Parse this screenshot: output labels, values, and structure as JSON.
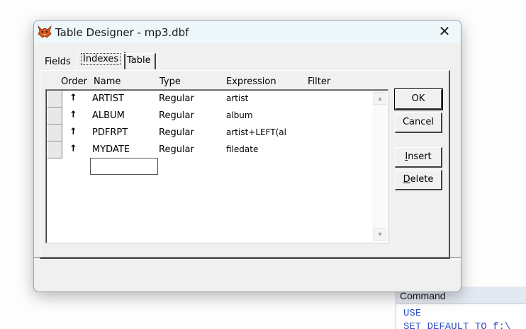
{
  "dialog": {
    "title": "Table Designer - mp3.dbf",
    "close_symbol": "✕"
  },
  "tabs": [
    {
      "label": "Fields"
    },
    {
      "label": "Indexes",
      "active": true
    },
    {
      "label": "Table"
    }
  ],
  "grid": {
    "columns": [
      "Order",
      "Name",
      "Type",
      "Expression",
      "Filter"
    ],
    "rows": [
      {
        "order": "↑",
        "name": "ARTIST",
        "type": "Regular",
        "expression": "artist"
      },
      {
        "order": "↑",
        "name": "ALBUM",
        "type": "Regular",
        "expression": "album"
      },
      {
        "order": "↑",
        "name": "PDFRPT",
        "type": "Regular",
        "expression": "artist+LEFT(al"
      },
      {
        "order": "↑",
        "name": "MYDATE",
        "type": "Regular",
        "expression": "filedate"
      }
    ],
    "new_row_value": ""
  },
  "buttons": {
    "ok": "OK",
    "cancel": "Cancel",
    "insert": "Insert",
    "delete": "Delete"
  },
  "command_window": {
    "title": "Command",
    "lines": [
      "USE",
      "SET DEFAULT TO f:\\"
    ]
  },
  "icons": {
    "app": "fox-icon",
    "scroll_up": "scroll-up-arrow-icon",
    "scroll_down": "scroll-down-arrow-icon"
  },
  "colors": {
    "titlebar": "#eef7f9",
    "command_text": "#2c4fc4",
    "fox_orange": "#d9581c"
  }
}
